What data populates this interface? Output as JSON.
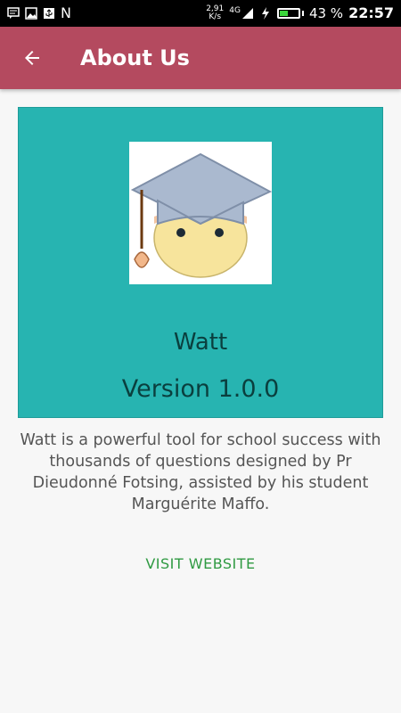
{
  "status_bar": {
    "speed_value": "2,91",
    "speed_unit": "K/s",
    "network": "4G",
    "battery_percent_text": "43 %",
    "battery_level": 0.43,
    "time": "22:57",
    "n_label": "N"
  },
  "app_bar": {
    "title": "About Us",
    "color": "#b44a5f"
  },
  "card": {
    "app_name": "Watt",
    "version": "Version 1.0.0",
    "background": "#27b4b1"
  },
  "description": "Watt is a powerful tool for school success with thousands of questions designed by Pr Dieudonné Fotsing, assisted by his student Marguérite Maffo.",
  "visit_button_label": "VISIT WEBSITE"
}
